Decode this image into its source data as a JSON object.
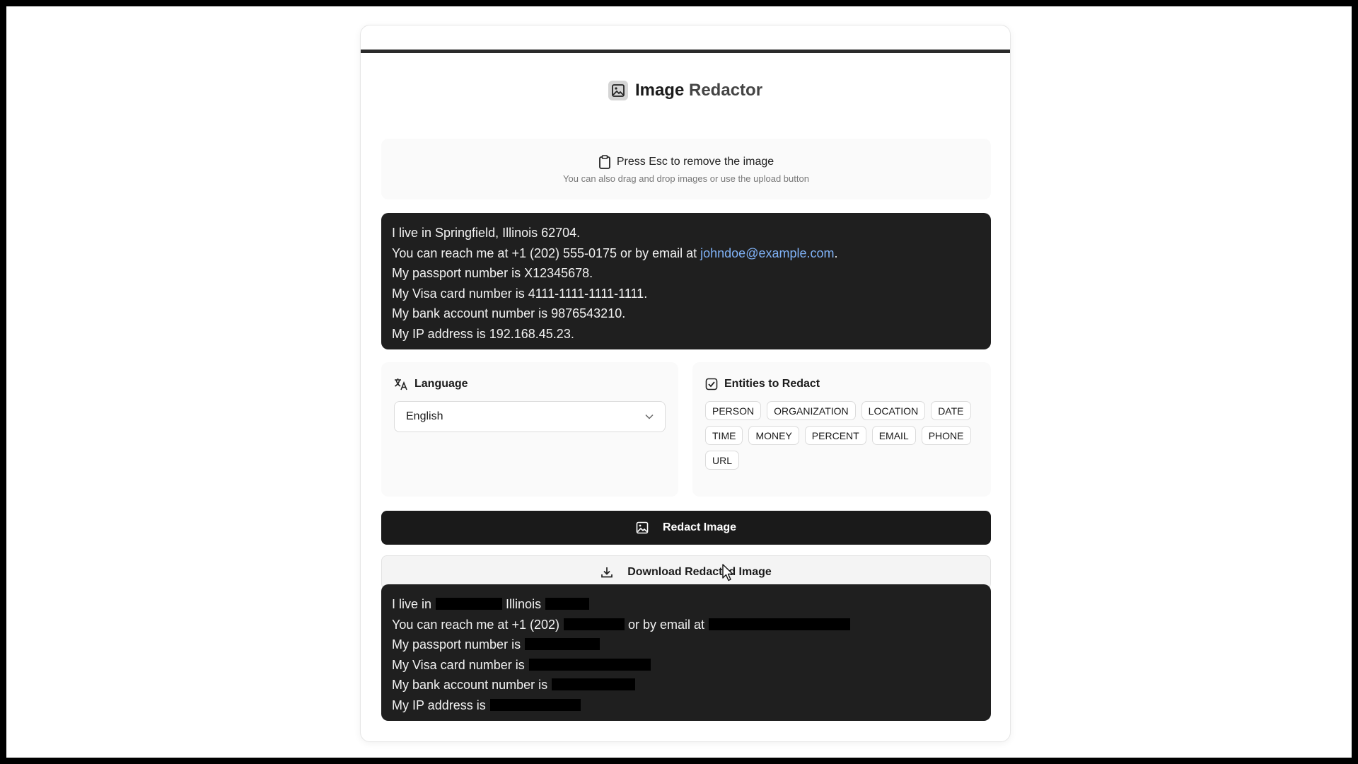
{
  "header": {
    "title_main": "Image",
    "title_accent": "Redactor",
    "icon": "image-icon"
  },
  "dropzone": {
    "icon": "clipboard-icon",
    "main_text": "Press Esc to remove the image",
    "sub_text": "You can also drag and drop images or use the upload button"
  },
  "original_text": {
    "lines": [
      "I live in Springfield, Illinois 62704.",
      "You can reach me at +1 (202) 555-0175 or by email at",
      "My passport number is X12345678.",
      "My Visa card number is 4111-1111-1111-1111.",
      "My bank account number is 9876543210.",
      "My IP address is 192.168.45.23."
    ],
    "email": "johndoe@example.com",
    "email_suffix": "."
  },
  "language": {
    "icon": "translate-icon",
    "label": "Language",
    "selected": "English"
  },
  "entities": {
    "icon": "checkbox-icon",
    "label": "Entities to Redact",
    "items": [
      "PERSON",
      "ORGANIZATION",
      "LOCATION",
      "DATE",
      "TIME",
      "MONEY",
      "PERCENT",
      "EMAIL",
      "PHONE",
      "URL"
    ]
  },
  "actions": {
    "redact_label": "Redact Image",
    "download_label": "Download Redacted Image"
  },
  "redacted_text": {
    "line1_a": "I live in",
    "line1_b": "Illinois",
    "line2_a": "You can reach me at +1 (202)",
    "line2_b": "or by email at",
    "line3": "My passport number is",
    "line4": "My Visa card number is",
    "line5": "My bank account number is",
    "line6": "My IP address is"
  }
}
